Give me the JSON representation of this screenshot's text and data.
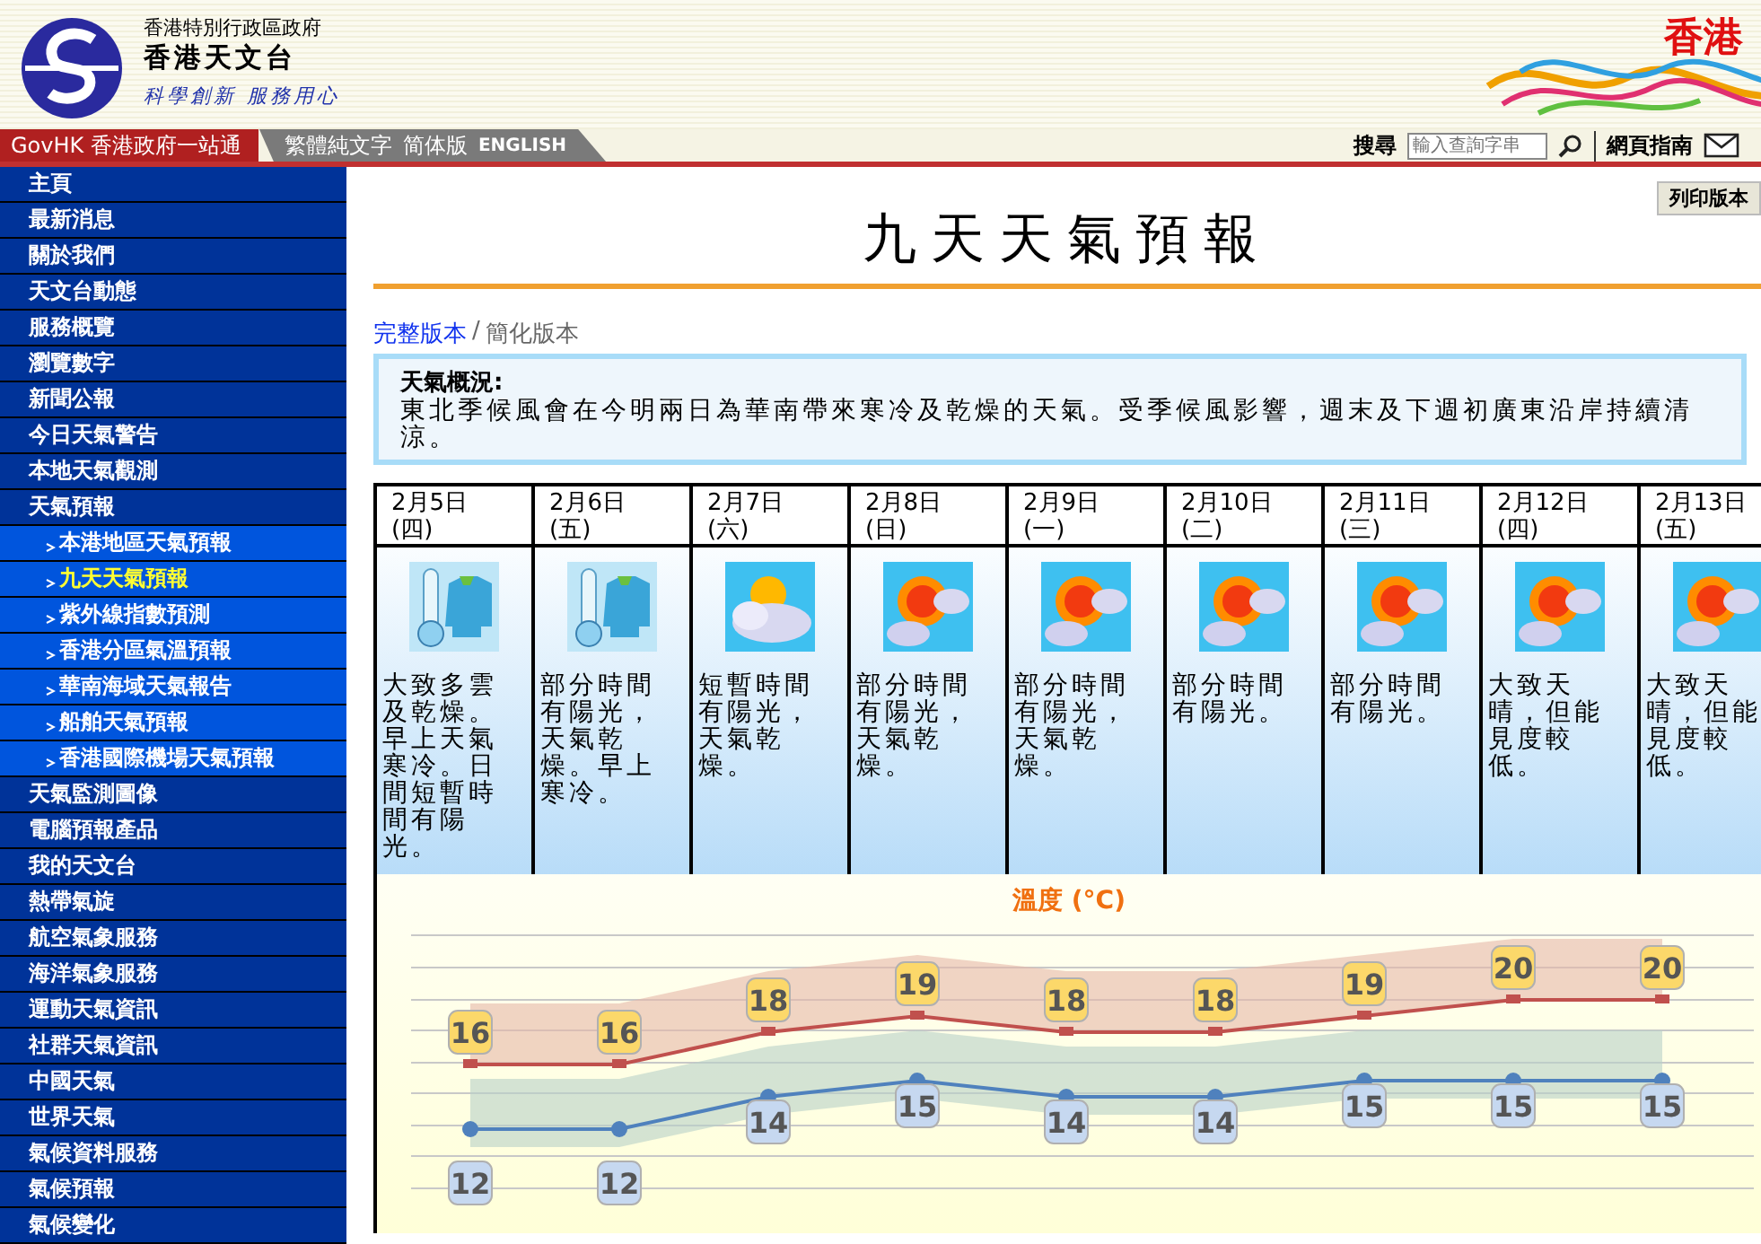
{
  "header": {
    "org_line": "香港特別行政區政府",
    "name": "香港天文台",
    "motto": "科學創新 服務用心",
    "brand_text": "香港"
  },
  "nav": {
    "govhk": "GovHK 香港政府一站通",
    "links": [
      "繁體純文字",
      "简体版",
      "ENGLISH"
    ],
    "search_label": "搜尋",
    "search_placeholder": "輸入查詢字串",
    "guide": "網頁指南"
  },
  "sidebar": {
    "items": [
      {
        "label": "主頁",
        "kind": "main",
        "selected": false
      },
      {
        "label": "最新消息",
        "kind": "main",
        "selected": false
      },
      {
        "label": "關於我們",
        "kind": "main",
        "selected": false
      },
      {
        "label": "天文台動態",
        "kind": "main",
        "selected": false
      },
      {
        "label": "服務概覽",
        "kind": "main",
        "selected": false
      },
      {
        "label": "瀏覽數字",
        "kind": "main",
        "selected": false
      },
      {
        "label": "新聞公報",
        "kind": "main",
        "selected": false
      },
      {
        "label": "今日天氣警告",
        "kind": "main",
        "selected": false
      },
      {
        "label": "本地天氣觀測",
        "kind": "main",
        "selected": false
      },
      {
        "label": "天氣預報",
        "kind": "main",
        "selected": false
      },
      {
        "label": "本港地區天氣預報",
        "kind": "sub",
        "selected": false
      },
      {
        "label": "九天天氣預報",
        "kind": "sub",
        "selected": true
      },
      {
        "label": "紫外線指數預測",
        "kind": "sub",
        "selected": false
      },
      {
        "label": "香港分區氣溫預報",
        "kind": "sub",
        "selected": false
      },
      {
        "label": "華南海域天氣報告",
        "kind": "sub",
        "selected": false
      },
      {
        "label": "船舶天氣預報",
        "kind": "sub",
        "selected": false
      },
      {
        "label": "香港國際機場天氣預報",
        "kind": "sub",
        "selected": false
      },
      {
        "label": "天氣監測圖像",
        "kind": "main",
        "selected": false
      },
      {
        "label": "電腦預報產品",
        "kind": "main",
        "selected": false
      },
      {
        "label": "我的天文台",
        "kind": "main",
        "selected": false
      },
      {
        "label": "熱帶氣旋",
        "kind": "main",
        "selected": false
      },
      {
        "label": "航空氣象服務",
        "kind": "main",
        "selected": false
      },
      {
        "label": "海洋氣象服務",
        "kind": "main",
        "selected": false
      },
      {
        "label": "運動天氣資訊",
        "kind": "main",
        "selected": false
      },
      {
        "label": "社群天氣資訊",
        "kind": "main",
        "selected": false
      },
      {
        "label": "中國天氣",
        "kind": "main",
        "selected": false
      },
      {
        "label": "世界天氣",
        "kind": "main",
        "selected": false
      },
      {
        "label": "氣候資料服務",
        "kind": "main",
        "selected": false
      },
      {
        "label": "氣候預報",
        "kind": "main",
        "selected": false
      },
      {
        "label": "氣候變化",
        "kind": "main",
        "selected": false
      }
    ]
  },
  "print_button": "列印版本",
  "title": "九天天氣預報",
  "versions": [
    {
      "label": "完整版本",
      "selected": false
    },
    {
      "label": "簡化版本",
      "selected": true
    }
  ],
  "versions_separator": "/",
  "outlook": {
    "heading": "天氣概況:",
    "text": "東北季候風會在今明兩日為華南帶來寒冷及乾燥的天氣。受季候風影響，週末及下週初廣東沿岸持續清涼。"
  },
  "days": [
    {
      "date": "2月5日",
      "weekday": "(四)",
      "kind": "cold",
      "forecast": "大致多雲及乾燥。早上天氣寒冷。日間短暫時間有陽光。"
    },
    {
      "date": "2月6日",
      "weekday": "(五)",
      "kind": "cold",
      "forecast": "部分時間有陽光，天氣乾燥。早上寒冷。"
    },
    {
      "date": "2月7日",
      "weekday": "(六)",
      "kind": "cloudy",
      "forecast": "短暫時間有陽光，天氣乾燥。"
    },
    {
      "date": "2月8日",
      "weekday": "(日)",
      "kind": "sunny",
      "forecast": "部分時間有陽光，天氣乾燥。"
    },
    {
      "date": "2月9日",
      "weekday": "(一)",
      "kind": "sunny",
      "forecast": "部分時間有陽光，天氣乾燥。"
    },
    {
      "date": "2月10日",
      "weekday": "(二)",
      "kind": "sunny",
      "forecast": "部分時間有陽光。"
    },
    {
      "date": "2月11日",
      "weekday": "(三)",
      "kind": "sunny",
      "forecast": "部分時間有陽光。"
    },
    {
      "date": "2月12日",
      "weekday": "(四)",
      "kind": "sunny",
      "forecast": "大致天晴，但能見度較低。"
    },
    {
      "date": "2月13日",
      "weekday": "(五)",
      "kind": "sunny",
      "forecast": "大致天晴，但能見度較低。"
    }
  ],
  "temperature": {
    "chart_data": {
      "type": "line",
      "title": "溫度 (°C)",
      "data_labels": true,
      "series": [
        {
          "color": "#c0504d",
          "marker": "square",
          "values": [
            16,
            16,
            18,
            19,
            18,
            18,
            19,
            20,
            20
          ]
        },
        {
          "color": "#4f81bd",
          "marker": "circle",
          "values": [
            12,
            12,
            14,
            15,
            14,
            14,
            15,
            15,
            15
          ]
        }
      ]
    }
  }
}
